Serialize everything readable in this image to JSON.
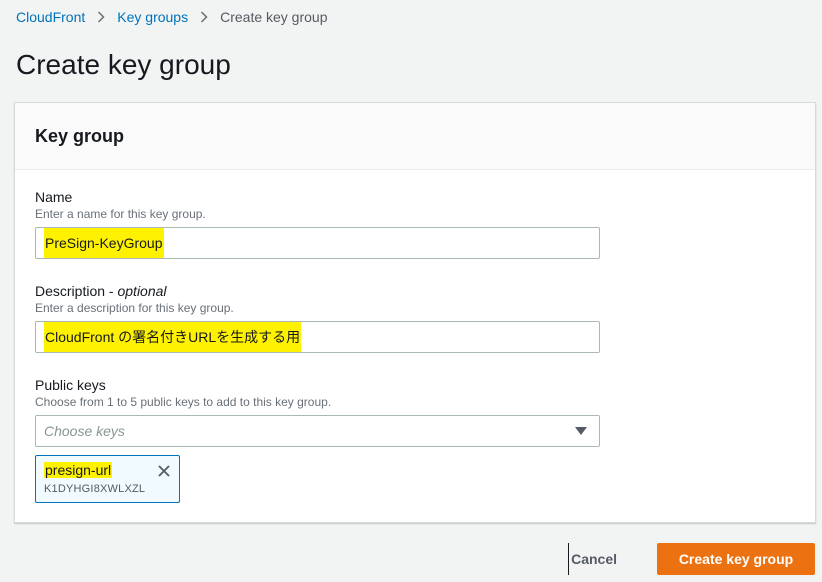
{
  "breadcrumb": {
    "items": [
      "CloudFront",
      "Key groups"
    ],
    "current": "Create key group"
  },
  "page_title": "Create key group",
  "panel": {
    "title": "Key group",
    "name": {
      "label": "Name",
      "description": "Enter a name for this key group.",
      "value": "PreSign-KeyGroup"
    },
    "description_field": {
      "label": "Description",
      "label_suffix": " - ",
      "optional": "optional",
      "description": "Enter a description for this key group.",
      "value": "CloudFront の署名付きURLを生成する用"
    },
    "public_keys": {
      "label": "Public keys",
      "description": "Choose from 1 to 5 public keys to add to this key group.",
      "placeholder": "Choose keys",
      "selected": [
        {
          "name": "presign-url",
          "id": "K1DYHGI8XWLXZL"
        }
      ]
    }
  },
  "actions": {
    "cancel": "Cancel",
    "submit": "Create key group"
  },
  "colors": {
    "link": "#0073bb",
    "primary_button": "#ec7211",
    "highlight": "#fff200",
    "token_border": "#0073bb"
  },
  "icons": [
    "chevron-right-icon",
    "caret-down-icon",
    "close-icon"
  ]
}
